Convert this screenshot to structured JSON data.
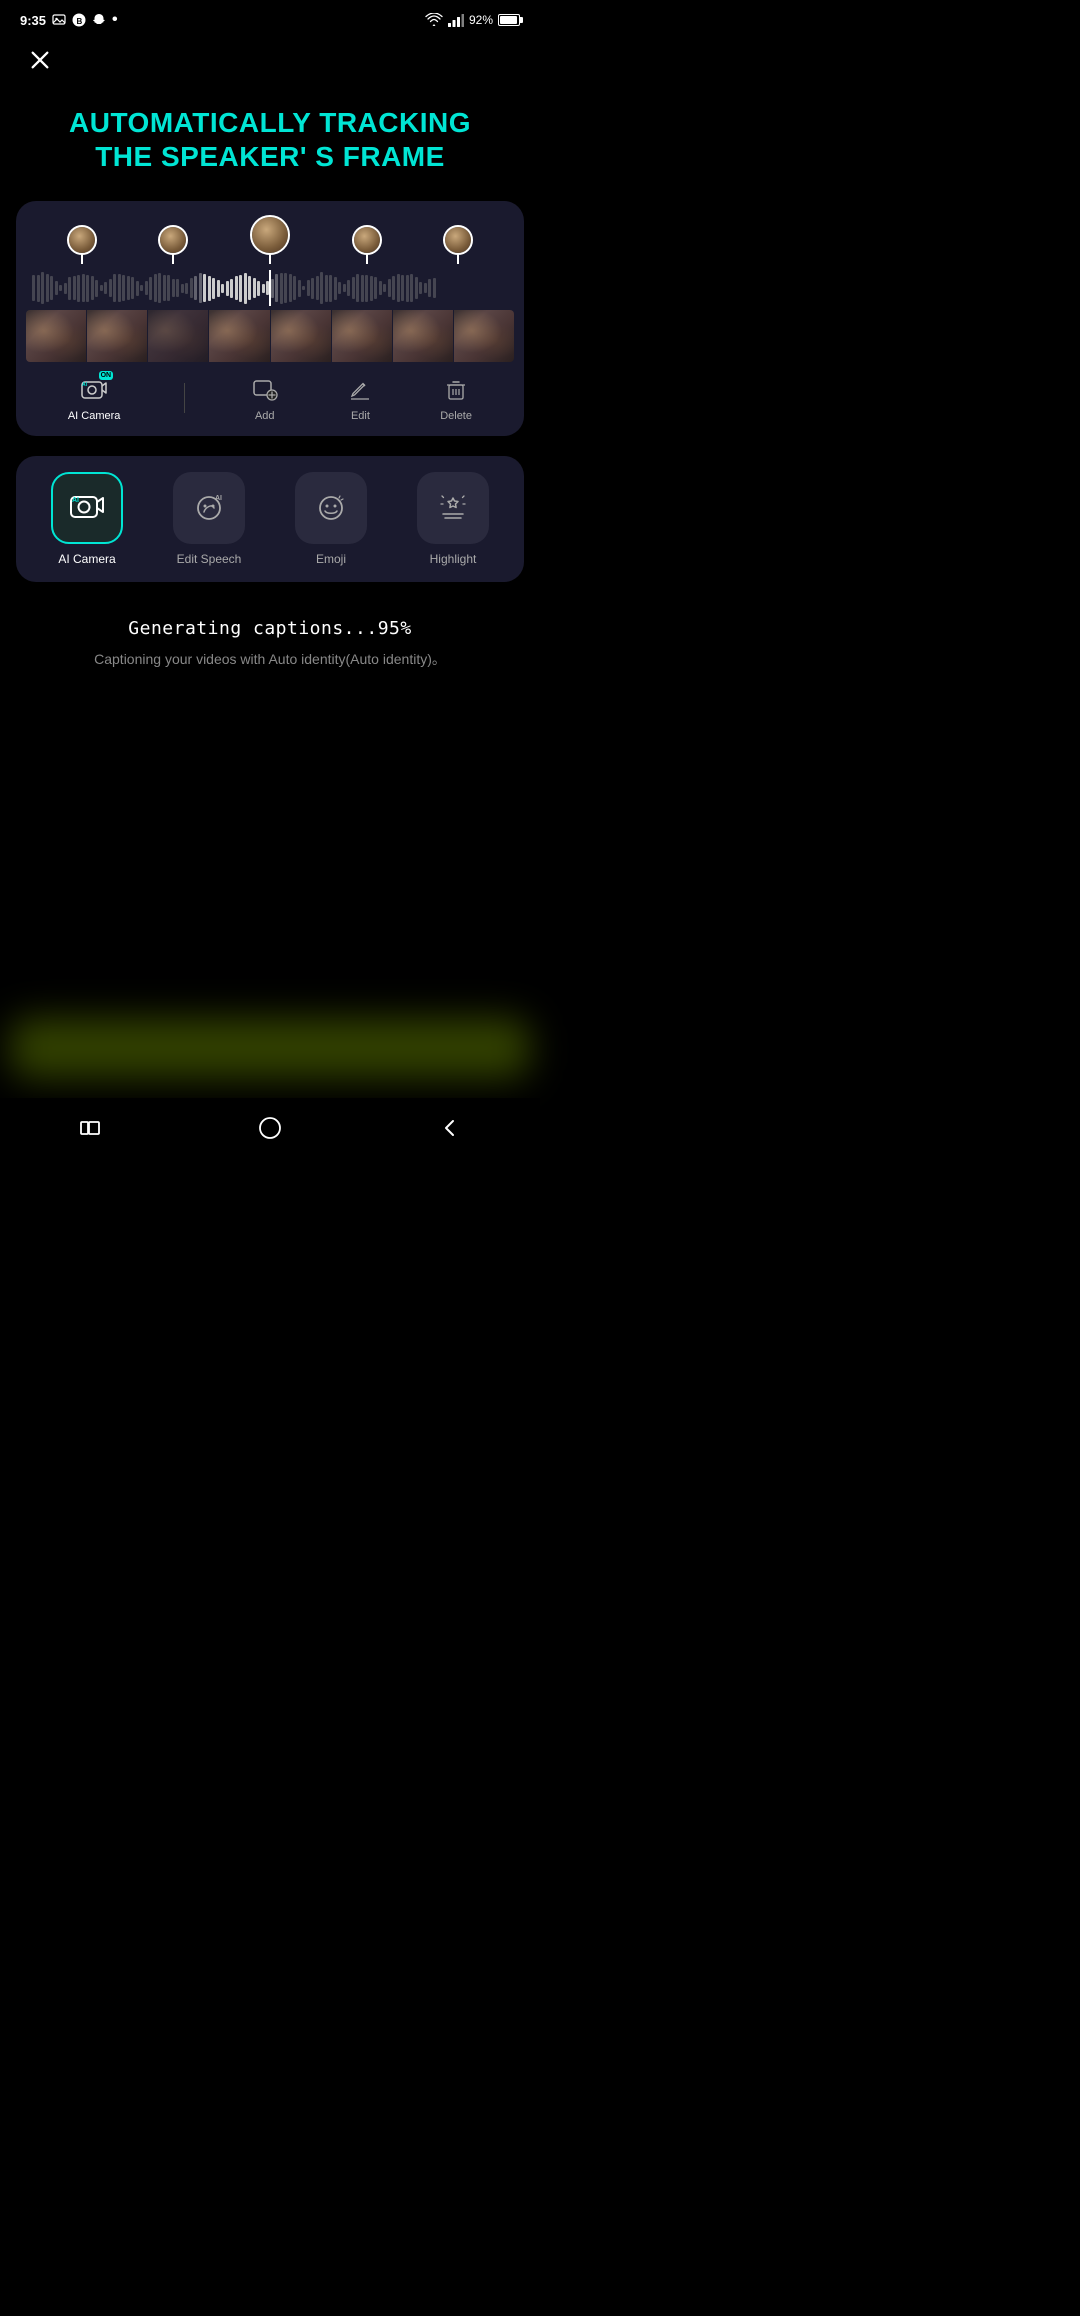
{
  "statusBar": {
    "time": "9:35",
    "battery": "92%",
    "signal": "strong"
  },
  "closeButton": {
    "label": "close"
  },
  "hero": {
    "line1": "AUTOMATICALLY TRACKING",
    "line2": "THE SPEAKER' S FRAME"
  },
  "timeline": {
    "speakerCount": 5,
    "activeIndex": 2
  },
  "panelToolbar": {
    "tools": [
      {
        "id": "ai-camera",
        "label": "AI Camera",
        "active": true
      },
      {
        "id": "add",
        "label": "Add",
        "active": false
      },
      {
        "id": "edit",
        "label": "Edit",
        "active": false
      },
      {
        "id": "delete",
        "label": "Delete",
        "active": false
      }
    ]
  },
  "featureBar": {
    "items": [
      {
        "id": "ai-camera",
        "label": "AI Camera",
        "selected": true
      },
      {
        "id": "edit-speech",
        "label": "Edit Speech",
        "selected": false
      },
      {
        "id": "emoji",
        "label": "Emoji",
        "selected": false
      },
      {
        "id": "highlight",
        "label": "Highlight",
        "selected": false
      }
    ]
  },
  "status": {
    "generating": "Generating captions...95%",
    "subtitle": "Captioning your videos with Auto identity(Auto identity)。"
  }
}
